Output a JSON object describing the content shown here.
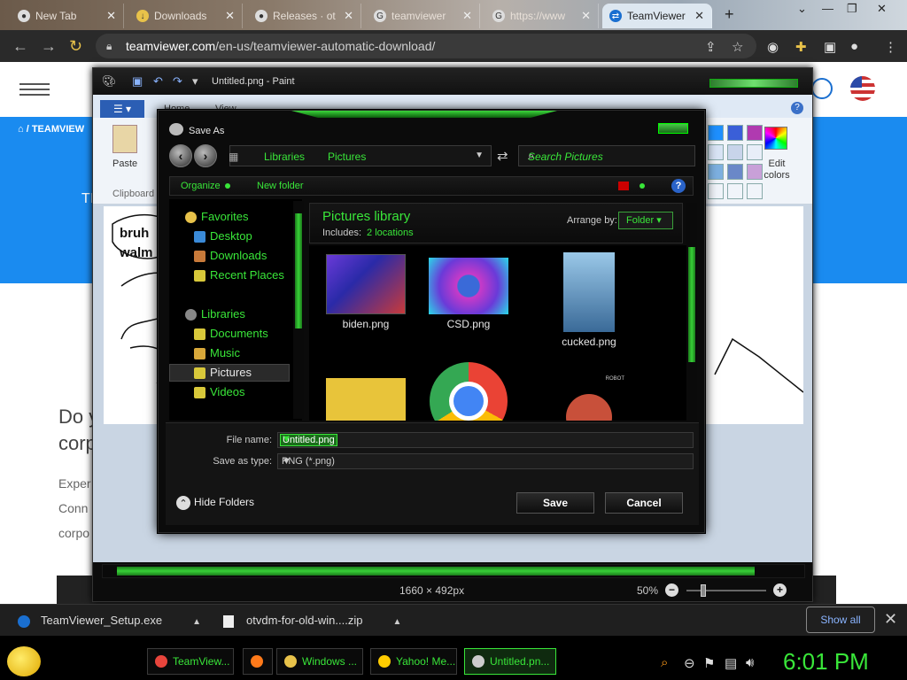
{
  "browser": {
    "tabs": [
      {
        "title": "New Tab",
        "icon": "github-icon"
      },
      {
        "title": "Downloads",
        "icon": "download-icon"
      },
      {
        "title": "Releases · ot",
        "icon": "github-icon"
      },
      {
        "title": "teamviewer",
        "icon": "google-icon"
      },
      {
        "title": "https://www",
        "icon": "google-icon"
      },
      {
        "title": "TeamViewer",
        "icon": "teamviewer-icon"
      }
    ],
    "url_domain": "teamviewer.com",
    "url_path": "/en-us/teamviewer-automatic-download/"
  },
  "webpage": {
    "breadcrumb": "TEAMVIEW",
    "heading_fragment": "TI",
    "body_heading_1": "Do y",
    "body_heading_2": "corp",
    "body_text_1": "Exper",
    "body_text_2": "Conn",
    "body_text_3": "corpo"
  },
  "paint": {
    "title": "Untitled.png - Paint",
    "tabs": [
      "Home",
      "View"
    ],
    "paste_label": "Paste",
    "clipboard_label": "Clipboard",
    "edit_colors_label": "Edit colors",
    "canvas_text_1": "bruh",
    "canvas_text_2": "walm",
    "dimensions": "1660 × 492px",
    "zoom": "50%",
    "palette": [
      "#1e90ff",
      "#3a5fd8",
      "#b03ab0",
      "#d9e4f5",
      "#c8d4ea",
      "#e8eef8",
      "#7db0e0",
      "#6a88c8",
      "#c8a0d8",
      "#f0f4fa",
      "#f0f4fa",
      "#f0f4fa"
    ]
  },
  "dialog": {
    "title": "Save As",
    "address": [
      "Libraries",
      "Pictures"
    ],
    "search_placeholder": "Search Pictures",
    "organize": "Organize",
    "new_folder": "New folder",
    "nav": [
      {
        "label": "Favorites",
        "icon": "star-icon",
        "header": true
      },
      {
        "label": "Desktop",
        "icon": "desktop-icon"
      },
      {
        "label": "Downloads",
        "icon": "downloads-folder-icon"
      },
      {
        "label": "Recent Places",
        "icon": "recent-places-icon"
      },
      {
        "label": "Libraries",
        "icon": "libraries-icon",
        "header": true
      },
      {
        "label": "Documents",
        "icon": "documents-icon"
      },
      {
        "label": "Music",
        "icon": "music-icon"
      },
      {
        "label": "Pictures",
        "icon": "pictures-icon",
        "selected": true
      },
      {
        "label": "Videos",
        "icon": "videos-icon"
      }
    ],
    "library_title": "Pictures library",
    "includes_label": "Includes:",
    "includes_value": "2 locations",
    "arrange_label": "Arrange by:",
    "arrange_value": "Folder",
    "files": [
      {
        "name": "biden.png"
      },
      {
        "name": "CSD.png"
      },
      {
        "name": "cucked.png"
      }
    ],
    "thumb_text": "ROBOT",
    "file_name_label": "File name:",
    "file_name_value": "Untitled.png",
    "save_type_label": "Save as type:",
    "save_type_value": "PNG (*.png)",
    "hide_folders": "Hide Folders",
    "save_button": "Save",
    "cancel_button": "Cancel"
  },
  "downloads": [
    {
      "name": "TeamViewer_Setup.exe",
      "icon": "teamviewer-icon"
    },
    {
      "name": "otvdm-for-old-win....zip",
      "icon": "zip-icon"
    }
  ],
  "show_all": "Show all",
  "taskbar": {
    "items": [
      {
        "label": "TeamView...",
        "icon": "chrome-icon",
        "color": "#e8453c"
      },
      {
        "label": "",
        "icon": "firefox-icon",
        "color": "#ff7a1a"
      },
      {
        "label": "Windows ...",
        "icon": "folder-icon",
        "color": "#e8c24a"
      },
      {
        "label": "Yahoo! Me...",
        "icon": "yahoo-messenger-icon",
        "color": "#ffcc00"
      },
      {
        "label": "Untitled.pn...",
        "icon": "paint-icon",
        "color": "#cccccc"
      }
    ],
    "clock": "6:01 PM"
  }
}
